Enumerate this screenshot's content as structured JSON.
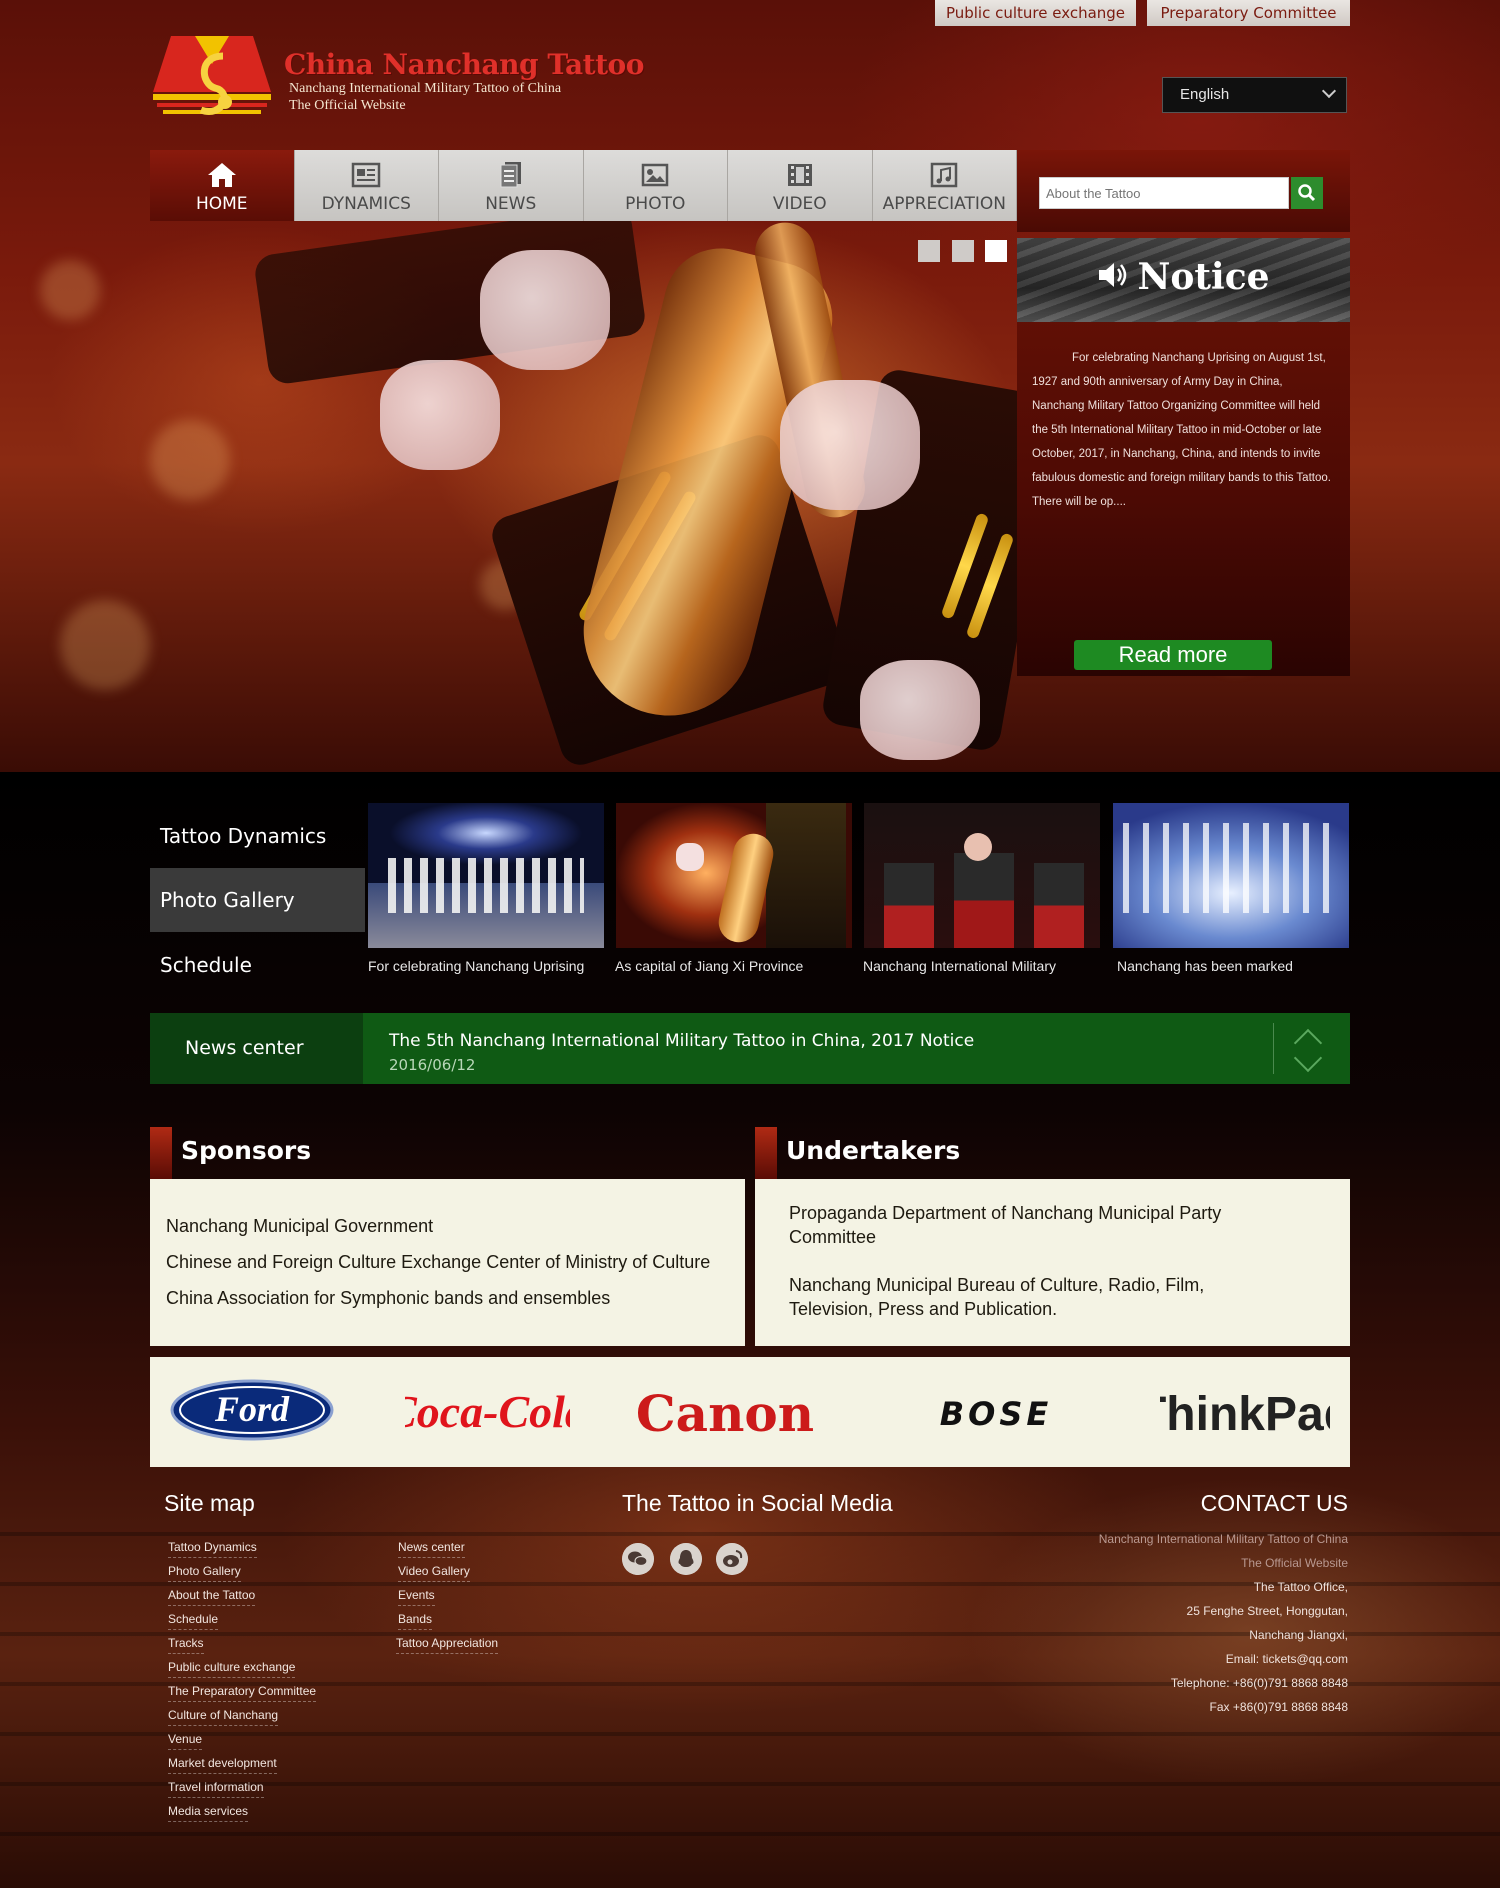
{
  "top_links": {
    "public": "Public culture exchange",
    "preparatory": "Preparatory Committee"
  },
  "logo": {
    "title": "China Nanchang Tattoo",
    "subtitle1": "Nanchang International Military Tattoo of China",
    "subtitle2": "The Official Website"
  },
  "language": {
    "selected": "English"
  },
  "nav": [
    {
      "label": "HOME",
      "icon": "home-icon",
      "active": true
    },
    {
      "label": "DYNAMICS",
      "icon": "newspaper-icon"
    },
    {
      "label": "NEWS",
      "icon": "document-icon"
    },
    {
      "label": "PHOTO",
      "icon": "image-icon"
    },
    {
      "label": "VIDEO",
      "icon": "film-icon"
    },
    {
      "label": "APPRECIATION",
      "icon": "music-note-icon"
    }
  ],
  "search": {
    "placeholder": "About the Tattoo"
  },
  "notice": {
    "title": "Notice",
    "text": "For celebrating Nanchang Uprising on August 1st, 1927 and 90th anniversary of Army Day in China, Nanchang Military Tattoo Organizing Committee will held the 5th International Military Tattoo in mid-October or late October, 2017, in Nanchang, China, and intends to invite fabulous domestic and foreign military bands to this Tattoo. There will be op....",
    "read_more": "Read more"
  },
  "side_tabs": {
    "dynamics": "Tattoo Dynamics",
    "gallery": "Photo Gallery",
    "schedule": "Schedule"
  },
  "thumbnails": [
    {
      "caption": "For celebrating Nanchang Uprising"
    },
    {
      "caption": "As capital of Jiang Xi Province"
    },
    {
      "caption": "Nanchang International Military"
    },
    {
      "caption": "Nanchang has been marked"
    }
  ],
  "news_center": {
    "label": "News center",
    "title": "The 5th Nanchang International Military Tattoo in China, 2017  Notice",
    "date": "2016/06/12"
  },
  "sponsors": {
    "title": "Sponsors",
    "items": [
      "Nanchang Municipal Government",
      "Chinese and Foreign Culture Exchange Center of Ministry of Culture",
      "China Association for Symphonic bands and ensembles"
    ]
  },
  "undertakers": {
    "title": "Undertakers",
    "items": [
      "Propaganda Department of Nanchang Municipal Party Committee",
      "Nanchang Municipal Bureau of Culture, Radio, Film, Television, Press and Publication."
    ]
  },
  "brands": {
    "ford": "Ford",
    "cocacola": "Coca-Cola",
    "canon": "Canon",
    "bose": "BOSE",
    "thinkpad": "ThinkPad"
  },
  "footer": {
    "sitemap_title": "Site map",
    "sitemap_col1": [
      "Tattoo Dynamics",
      "Photo Gallery",
      "About the Tattoo",
      "Schedule",
      "Tracks",
      "Public culture exchange",
      "The Preparatory Committee",
      "Culture of Nanchang",
      "Venue",
      "Market development",
      "Travel information",
      "Media services"
    ],
    "sitemap_col2": [
      "News center",
      "Video Gallery",
      "Events",
      "Bands",
      "Tattoo Appreciation"
    ],
    "social_title": "The Tattoo in Social Media",
    "social_icons": [
      "wechat-icon",
      "qq-icon",
      "weibo-icon"
    ],
    "contact_title": "CONTACT US",
    "contact": [
      "Nanchang International Military Tattoo of China",
      "The Official Website",
      "The Tattoo Office,",
      "25 Fenghe Street, Honggutan,",
      "Nanchang Jiangxi,",
      "Email: tickets@qq.com",
      "Telephone: +86(0)791 8868 8848",
      "Fax +86(0)791 8868 8848"
    ]
  }
}
